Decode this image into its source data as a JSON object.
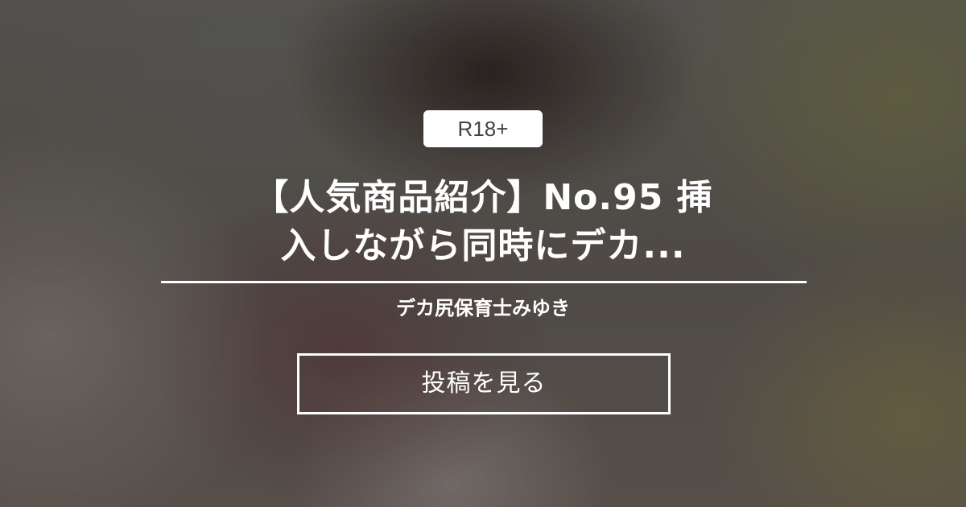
{
  "badge": {
    "label": "R18+"
  },
  "post": {
    "title_line_1": "【人気商品紹介】No.95 挿",
    "title_line_2": "入しながら同時にデカ...",
    "author": "デカ尻保育士みゆき"
  },
  "actions": {
    "view_post_label": "投稿を見る"
  },
  "colors": {
    "text": "#ffffff",
    "badge_background": "#ffffff",
    "badge_text": "#444444"
  }
}
